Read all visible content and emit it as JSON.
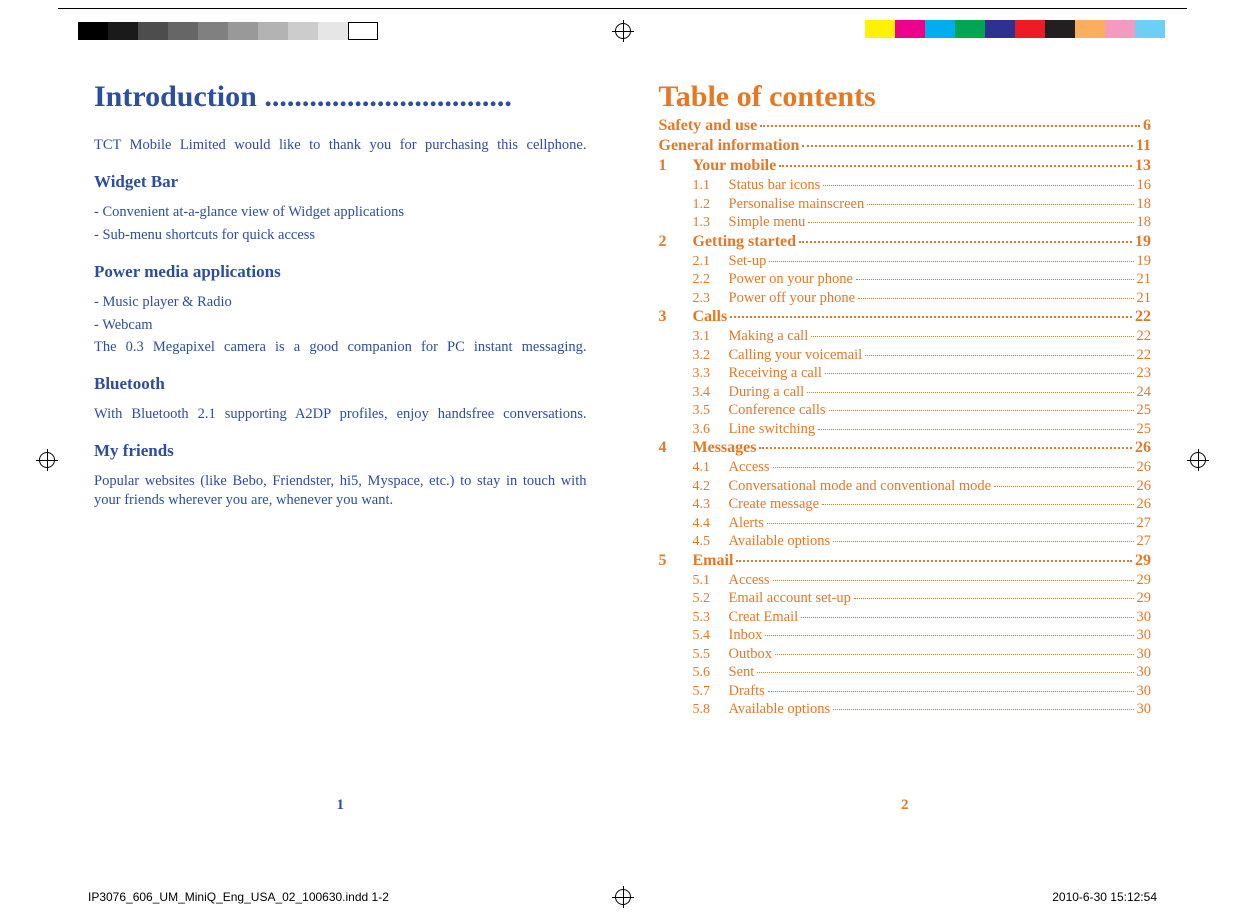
{
  "left_page": {
    "title": "Introduction .................................",
    "intro_text": "TCT Mobile Limited would like to thank you for purchasing this cellphone.",
    "sections": [
      {
        "heading": "Widget Bar",
        "lines": [
          "- Convenient at-a-glance view of Widget applications",
          "- Sub-menu shortcuts for quick access"
        ]
      },
      {
        "heading": "Power media applications",
        "lines": [
          "- Music player & Radio",
          "- Webcam"
        ],
        "para": "The 0.3 Megapixel camera is a good companion for PC instant messaging."
      },
      {
        "heading": "Bluetooth",
        "para": "With Bluetooth 2.1 supporting A2DP profiles, enjoy handsfree conversations."
      },
      {
        "heading": "My friends",
        "para": "Popular websites (like Bebo, Friendster, hi5, Myspace, etc.) to stay in touch with your friends wherever you are, whenever you want."
      }
    ],
    "page_number": "1"
  },
  "right_page": {
    "title": "Table of contents",
    "toc": [
      {
        "type": "main",
        "num": "",
        "label": "Safety and use",
        "page": "6"
      },
      {
        "type": "main",
        "num": "",
        "label": "General information",
        "page": "11"
      },
      {
        "type": "main",
        "num": "1",
        "label": "Your mobile",
        "page": "13"
      },
      {
        "type": "sub",
        "num": "1.1",
        "label": "Status bar icons",
        "page": "16"
      },
      {
        "type": "sub",
        "num": "1.2",
        "label": "Personalise mainscreen",
        "page": "18"
      },
      {
        "type": "sub",
        "num": "1.3",
        "label": "Simple menu",
        "page": "18"
      },
      {
        "type": "main",
        "num": "2",
        "label": "Getting started",
        "page": "19"
      },
      {
        "type": "sub",
        "num": "2.1",
        "label": "Set-up",
        "page": "19"
      },
      {
        "type": "sub",
        "num": "2.2",
        "label": "Power on your phone",
        "page": "21"
      },
      {
        "type": "sub",
        "num": "2.3",
        "label": "Power off your phone",
        "page": "21"
      },
      {
        "type": "main",
        "num": "3",
        "label": "Calls",
        "page": "22"
      },
      {
        "type": "sub",
        "num": "3.1",
        "label": "Making a call",
        "page": "22"
      },
      {
        "type": "sub",
        "num": "3.2",
        "label": "Calling your voicemail",
        "page": "22"
      },
      {
        "type": "sub",
        "num": "3.3",
        "label": "Receiving a call",
        "page": "23"
      },
      {
        "type": "sub",
        "num": "3.4",
        "label": "During a call",
        "page": "24"
      },
      {
        "type": "sub",
        "num": "3.5",
        "label": "Conference calls",
        "page": "25"
      },
      {
        "type": "sub",
        "num": "3.6",
        "label": "Line switching",
        "page": "25"
      },
      {
        "type": "main",
        "num": "4",
        "label": "Messages",
        "page": "26"
      },
      {
        "type": "sub",
        "num": "4.1",
        "label": "Access",
        "page": "26"
      },
      {
        "type": "sub",
        "num": "4.2",
        "label": "Conversational mode and conventional mode",
        "page": "26"
      },
      {
        "type": "sub",
        "num": "4.3",
        "label": "Create message",
        "page": "26"
      },
      {
        "type": "sub",
        "num": "4.4",
        "label": "Alerts",
        "page": "27"
      },
      {
        "type": "sub",
        "num": "4.5",
        "label": "Available options",
        "page": "27"
      },
      {
        "type": "main",
        "num": "5",
        "label": "Email",
        "page": "29"
      },
      {
        "type": "sub",
        "num": "5.1",
        "label": "Access",
        "page": "29"
      },
      {
        "type": "sub",
        "num": "5.2",
        "label": "Email account set-up",
        "page": "29"
      },
      {
        "type": "sub",
        "num": "5.3",
        "label": "Creat Email",
        "page": "30"
      },
      {
        "type": "sub",
        "num": "5.4",
        "label": "Inbox",
        "page": "30"
      },
      {
        "type": "sub",
        "num": "5.5",
        "label": "Outbox",
        "page": "30"
      },
      {
        "type": "sub",
        "num": "5.6",
        "label": "Sent",
        "page": "30"
      },
      {
        "type": "sub",
        "num": "5.7",
        "label": "Drafts",
        "page": "30"
      },
      {
        "type": "sub",
        "num": "5.8",
        "label": "Available options",
        "page": "30"
      }
    ],
    "page_number": "2"
  },
  "footer": {
    "file": "IP3076_606_UM_MiniQ_Eng_USA_02_100630.indd   1-2",
    "timestamp": "2010-6-30   15:12:54"
  },
  "crop": {
    "grays": [
      "#000000",
      "#1a1a1a",
      "#4d4d4d",
      "#666666",
      "#808080",
      "#999999",
      "#b3b3b3",
      "#cccccc",
      "#e6e6e6",
      "#ffffff"
    ],
    "colors": [
      "#fff200",
      "#ec008c",
      "#00aeef",
      "#00a651",
      "#2e3192",
      "#ed1c24",
      "#231f20",
      "#fbaf5d",
      "#f49ac1",
      "#6dcff6"
    ]
  }
}
